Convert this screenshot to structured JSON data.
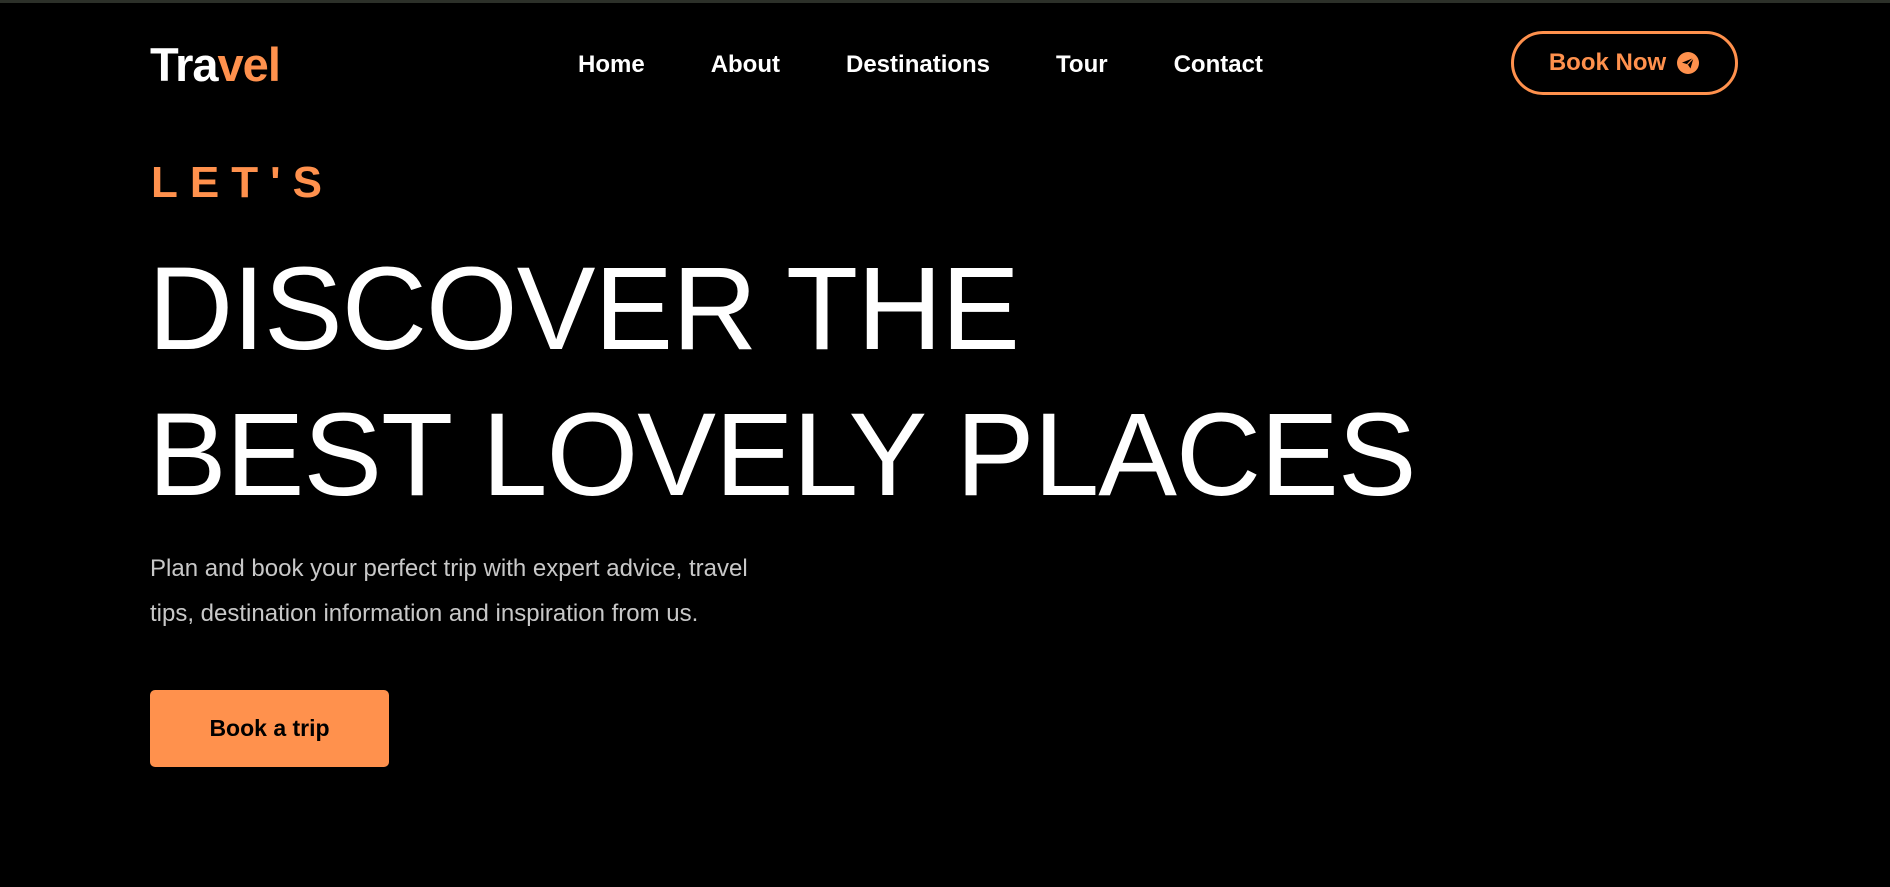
{
  "colors": {
    "accent": "#ff914d",
    "background": "#000000",
    "text": "#ffffff",
    "muted_text": "#c8c8c8"
  },
  "header": {
    "logo_part_a": "Tra",
    "logo_part_b": "vel",
    "nav": [
      {
        "label": "Home"
      },
      {
        "label": "About"
      },
      {
        "label": "Destinations"
      },
      {
        "label": "Tour"
      },
      {
        "label": "Contact"
      }
    ],
    "cta": {
      "label": "Book Now",
      "icon": "send-icon"
    }
  },
  "hero": {
    "kicker": "LET'S",
    "title_line_1": "DISCOVER THE",
    "title_line_2": "BEST LOVELY PLACES",
    "description": "Plan and book your perfect trip with expert advice, travel tips, destination information and inspiration from us.",
    "button_label": "Book a trip"
  }
}
